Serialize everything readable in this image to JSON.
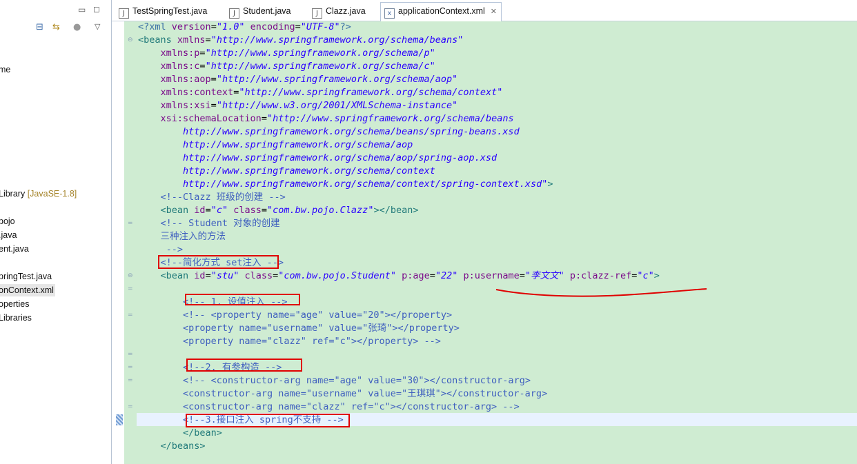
{
  "explorer": {
    "items": [
      {
        "label": "me"
      },
      {
        "label": "Library ",
        "extra": "[JavaSE-1.8]"
      },
      {
        "label": "pojo"
      },
      {
        "label": ".java"
      },
      {
        "label": "ent.java"
      },
      {
        "label": "pringTest.java"
      },
      {
        "label": "onContext.xml"
      },
      {
        "label": "operties"
      },
      {
        "label": " Libraries"
      }
    ]
  },
  "tabs": [
    {
      "label": "TestSpringTest.java",
      "icon": "java-file-icon"
    },
    {
      "label": "Student.java",
      "icon": "java-file-icon"
    },
    {
      "label": "Clazz.java",
      "icon": "java-file-icon"
    },
    {
      "label": "applicationContext.xml",
      "icon": "xml-file-icon",
      "active": true,
      "close": "✕"
    }
  ],
  "editor": {
    "lines": [
      [
        [
          "pi",
          "<?xml "
        ],
        [
          "at",
          "version"
        ],
        [
          "",
          "="
        ],
        [
          "av",
          "\"1.0\""
        ],
        [
          "",
          ""
        ],
        [
          "at",
          " encoding"
        ],
        [
          "",
          "="
        ],
        [
          "av",
          "\"UTF-8\""
        ],
        [
          "pi",
          "?>"
        ]
      ],
      [
        [
          "tg",
          "<beans "
        ],
        [
          "at",
          "xmlns"
        ],
        [
          "",
          "="
        ],
        [
          "av",
          "\"http://www.springframework.org/schema/beans\""
        ]
      ],
      [
        [
          "",
          "    "
        ],
        [
          "at",
          "xmlns:p"
        ],
        [
          "",
          "="
        ],
        [
          "av",
          "\"http://www.springframework.org/schema/p\""
        ]
      ],
      [
        [
          "",
          "    "
        ],
        [
          "at",
          "xmlns:c"
        ],
        [
          "",
          "="
        ],
        [
          "av",
          "\"http://www.springframework.org/schema/c\""
        ]
      ],
      [
        [
          "",
          "    "
        ],
        [
          "at",
          "xmlns:aop"
        ],
        [
          "",
          "="
        ],
        [
          "av",
          "\"http://www.springframework.org/schema/aop\""
        ]
      ],
      [
        [
          "",
          "    "
        ],
        [
          "at",
          "xmlns:context"
        ],
        [
          "",
          "="
        ],
        [
          "av",
          "\"http://www.springframework.org/schema/context\""
        ]
      ],
      [
        [
          "",
          "    "
        ],
        [
          "at",
          "xmlns:xsi"
        ],
        [
          "",
          "="
        ],
        [
          "av",
          "\"http://www.w3.org/2001/XMLSchema-instance\""
        ]
      ],
      [
        [
          "",
          "    "
        ],
        [
          "at",
          "xsi:schemaLocation"
        ],
        [
          "",
          "="
        ],
        [
          "av",
          "\"http://www.springframework.org/schema/beans"
        ]
      ],
      [
        [
          "",
          "        "
        ],
        [
          "av",
          "http://www.springframework.org/schema/beans/spring-beans.xsd"
        ]
      ],
      [
        [
          "",
          "        "
        ],
        [
          "av",
          "http://www.springframework.org/schema/aop"
        ]
      ],
      [
        [
          "",
          "        "
        ],
        [
          "av",
          "http://www.springframework.org/schema/aop/spring-aop.xsd"
        ]
      ],
      [
        [
          "",
          "        "
        ],
        [
          "av",
          "http://www.springframework.org/schema/context"
        ]
      ],
      [
        [
          "",
          "        "
        ],
        [
          "av",
          "http://www.springframework.org/schema/context/spring-context.xsd\""
        ],
        [
          "tg",
          ">"
        ]
      ],
      [
        [
          "",
          "    "
        ],
        [
          "cm",
          "<!--Clazz 班级的创建 -->"
        ]
      ],
      [
        [
          "",
          "    "
        ],
        [
          "tg",
          "<bean "
        ],
        [
          "at",
          "id"
        ],
        [
          "",
          "="
        ],
        [
          "av",
          "\"c\""
        ],
        [
          "at",
          " class"
        ],
        [
          "",
          "="
        ],
        [
          "av",
          "\"com.bw.pojo.Clazz\""
        ],
        [
          "tg",
          "></bean>"
        ]
      ],
      [
        [
          "",
          "    "
        ],
        [
          "cm",
          "<!-- Student 对象的创建"
        ]
      ],
      [
        [
          "",
          "    "
        ],
        [
          "cm",
          "三种注入的方法"
        ]
      ],
      [
        [
          "",
          "     "
        ],
        [
          "cm",
          "-->"
        ]
      ],
      [
        [
          "",
          "    "
        ],
        [
          "cm",
          "<!--简化方式 set注入 -->"
        ]
      ],
      [
        [
          "",
          "    "
        ],
        [
          "tg",
          "<bean "
        ],
        [
          "at",
          "id"
        ],
        [
          "",
          "="
        ],
        [
          "av",
          "\"stu\""
        ],
        [
          "at",
          " class"
        ],
        [
          "",
          "="
        ],
        [
          "av",
          "\"com.bw.pojo.Student\""
        ],
        [
          "at",
          " p:age"
        ],
        [
          "",
          "="
        ],
        [
          "av",
          "\"22\""
        ],
        [
          "at",
          " p:username"
        ],
        [
          "",
          "="
        ],
        [
          "av",
          "\"李文文\""
        ],
        [
          "at",
          " p:clazz-ref"
        ],
        [
          "",
          "="
        ],
        [
          "av",
          "\"c\""
        ],
        [
          "tg",
          ">"
        ]
      ],
      [
        [
          "",
          ""
        ]
      ],
      [
        [
          "",
          "        "
        ],
        [
          "cm",
          "<!-- 1. 设值注入 -->"
        ]
      ],
      [
        [
          "",
          "        "
        ],
        [
          "cm",
          "<!-- <property name=\"age\" value=\"20\"></property>"
        ]
      ],
      [
        [
          "",
          "        "
        ],
        [
          "cm",
          "<property name=\"username\" value=\"张琦\"></property>"
        ]
      ],
      [
        [
          "",
          "        "
        ],
        [
          "cm",
          "<property name=\"clazz\" ref=\"c\"></property> -->"
        ]
      ],
      [
        [
          "",
          ""
        ]
      ],
      [
        [
          "",
          "        "
        ],
        [
          "cm",
          "<!--2. 有参构造 -->"
        ]
      ],
      [
        [
          "",
          "        "
        ],
        [
          "cm",
          "<!-- <constructor-arg name=\"age\" value=\"30\"></constructor-arg>"
        ]
      ],
      [
        [
          "",
          "        "
        ],
        [
          "cm",
          "<constructor-arg name=\"username\" value=\"王琪琪\"></constructor-arg>"
        ]
      ],
      [
        [
          "",
          "        "
        ],
        [
          "cm",
          "<constructor-arg name=\"clazz\" ref=\"c\"></constructor-arg> -->"
        ]
      ],
      [
        [
          "",
          "        "
        ],
        [
          "cm",
          "<!--3.接口注入 spring不支持 -->"
        ]
      ],
      [
        [
          "",
          "        "
        ],
        [
          "tg",
          "</bean>"
        ]
      ],
      [
        [
          "",
          "    "
        ],
        [
          "tg",
          "</beans>"
        ]
      ]
    ]
  },
  "colors": {
    "editor_bg": "#cfecd2",
    "annotation_red": "#e00000",
    "comment": "#3f5fbf",
    "attr_value": "#2a00ff",
    "attr_name": "#7a0a8a",
    "tag": "#217a7a"
  }
}
